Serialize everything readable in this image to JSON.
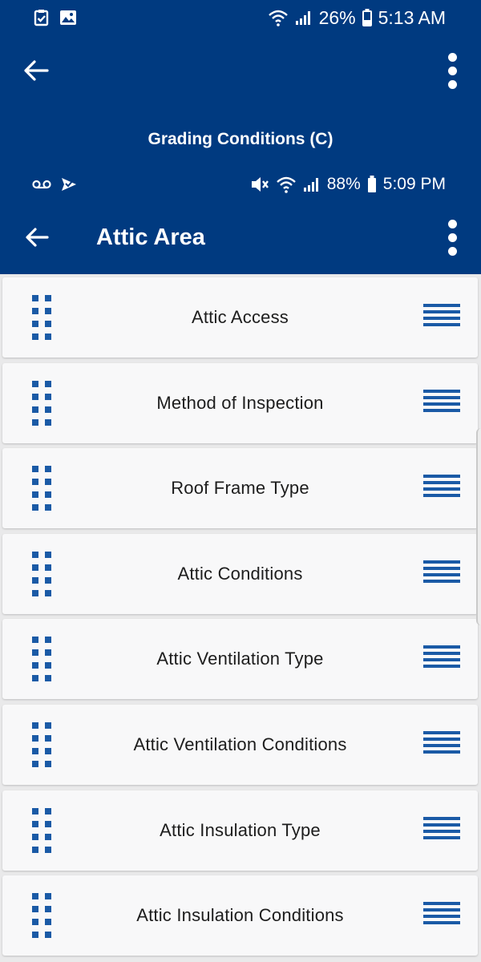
{
  "outer": {
    "status": {
      "battery": "26%",
      "time": "5:13 AM"
    },
    "title": "Grading Conditions (C)"
  },
  "inner": {
    "status": {
      "battery": "88%",
      "time": "5:09 PM"
    },
    "title": "Attic Area"
  },
  "icons": {
    "back": "arrow-left-icon",
    "menu": "more-vert-icon",
    "drag": "drag-handle-icon",
    "reorder": "reorder-icon"
  },
  "colors": {
    "header": "#003a80",
    "accent": "#1a5aa6",
    "background": "#e9e9ea"
  },
  "items": [
    {
      "label": "Attic Access"
    },
    {
      "label": "Method of Inspection"
    },
    {
      "label": "Roof Frame Type"
    },
    {
      "label": "Attic Conditions"
    },
    {
      "label": "Attic Ventilation Type"
    },
    {
      "label": "Attic Ventilation Conditions"
    },
    {
      "label": "Attic Insulation Type"
    },
    {
      "label": "Attic Insulation Conditions"
    }
  ]
}
